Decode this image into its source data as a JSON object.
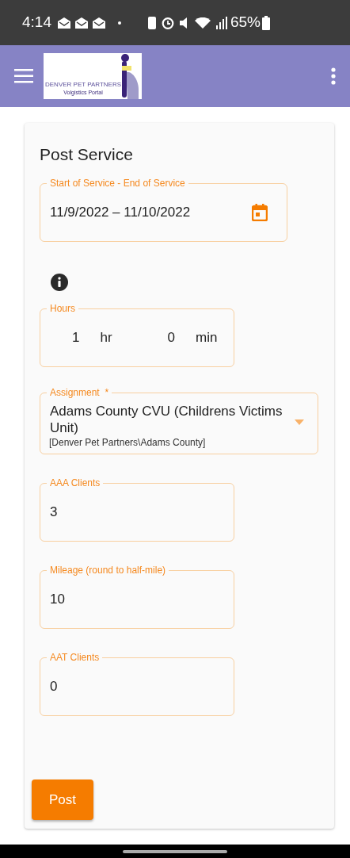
{
  "status_bar": {
    "time": "4:14",
    "battery": "65%"
  },
  "app_bar": {
    "logo": {
      "title": "DENVER PET PARTNERS",
      "subtitle": "Volgistics Portal"
    }
  },
  "form": {
    "title": "Post Service",
    "fields": [
      {
        "kind": "date",
        "label": "Start of Service - End of Service",
        "value": "11/9/2022 – 11/10/2022"
      },
      {
        "kind": "info"
      },
      {
        "kind": "hours",
        "label": "Hours",
        "hours": "1",
        "hours_unit": "hr",
        "minutes": "0",
        "minutes_unit": "min"
      },
      {
        "kind": "select",
        "label": "Assignment",
        "required_mark": "*",
        "value": "Adams County CVU (Childrens Victims Unit)",
        "detail": "[Denver Pet Partners\\Adams County]"
      },
      {
        "kind": "text",
        "label": "AAA Clients",
        "value": "3"
      },
      {
        "kind": "text",
        "label": "Mileage (round to half-mile)",
        "value": "10"
      },
      {
        "kind": "text",
        "label": "AAT Clients",
        "value": "0"
      }
    ],
    "submit": "Post"
  }
}
